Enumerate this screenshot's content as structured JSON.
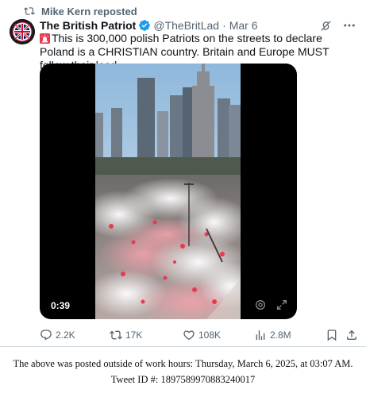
{
  "repost": {
    "icon": "repost-icon",
    "text": "Mike Kern reposted"
  },
  "author": {
    "avatar_icon": "british-patriot-avatar-icon",
    "display_name": "The British Patriot",
    "verified_icon": "verified-badge-icon",
    "handle": "@TheBritLad",
    "separator": "·",
    "date": "Mar 6"
  },
  "header_icons": [
    "grok-icon",
    "more-options-icon"
  ],
  "tweet": {
    "emoji_icon": "siren-emoji-icon",
    "text": "This is 300,000 polish Patriots on the streets to declare Poland is a CHRISTIAN country. Britain and Europe MUST follow their lead."
  },
  "media": {
    "kind": "video",
    "duration": "0:39",
    "controls": [
      "settings-gear-icon",
      "fullscreen-expand-icon"
    ]
  },
  "actions": {
    "replies": "2.2K",
    "reposts": "17K",
    "likes": "108K",
    "views": "2.8M",
    "bookmark_icon": "bookmark-icon",
    "share_icon": "share-icon"
  },
  "note": {
    "line1": "The above was posted outside of work hours: Thursday, March 6, 2025, at 03:07 AM.",
    "line2": "Tweet ID #: 1897589970883240017"
  },
  "colors": {
    "text_primary": "#0f1419",
    "text_secondary": "#536471",
    "verified_blue": "#1d9bf0",
    "flare_red": "#e8394d"
  }
}
